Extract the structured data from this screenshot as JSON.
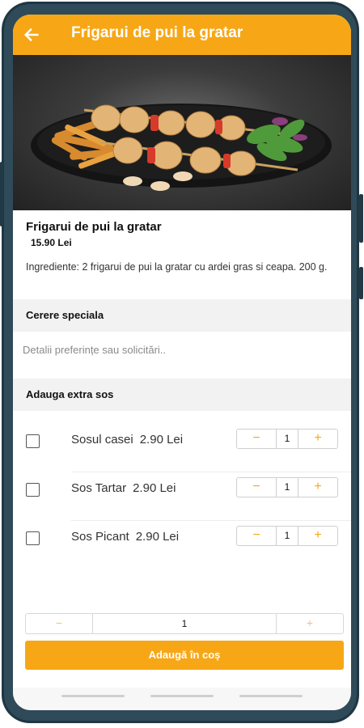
{
  "header": {
    "title": "Frigarui de pui la gratar",
    "back_icon": "arrow-left-icon",
    "color": "#f7a716"
  },
  "product": {
    "name": "Frigarui de pui la gratar",
    "price": "15.90 Lei",
    "description": "Ingrediente: 2 frigarui de pui la gratar cu ardei gras si ceapa. 200 g."
  },
  "special_request": {
    "title": "Cerere speciala",
    "placeholder": "Detalii preferințe sau solicitări.."
  },
  "extra_sauce": {
    "title": "Adauga extra sos",
    "items": [
      {
        "name": "Sosul casei",
        "price": "2.90 Lei",
        "qty": "1",
        "minus": "−",
        "plus": "+"
      },
      {
        "name": "Sos Tartar",
        "price": "2.90 Lei",
        "qty": "1",
        "minus": "−",
        "plus": "+"
      },
      {
        "name": "Sos Picant",
        "price": "2.90 Lei",
        "qty": "1",
        "minus": "−",
        "plus": "+"
      }
    ]
  },
  "order": {
    "qty": "1",
    "minus": "−",
    "plus": "+",
    "add_label": "Adaugă în coș"
  },
  "colors": {
    "accent": "#f7a716",
    "frame": "#2f4a58"
  }
}
